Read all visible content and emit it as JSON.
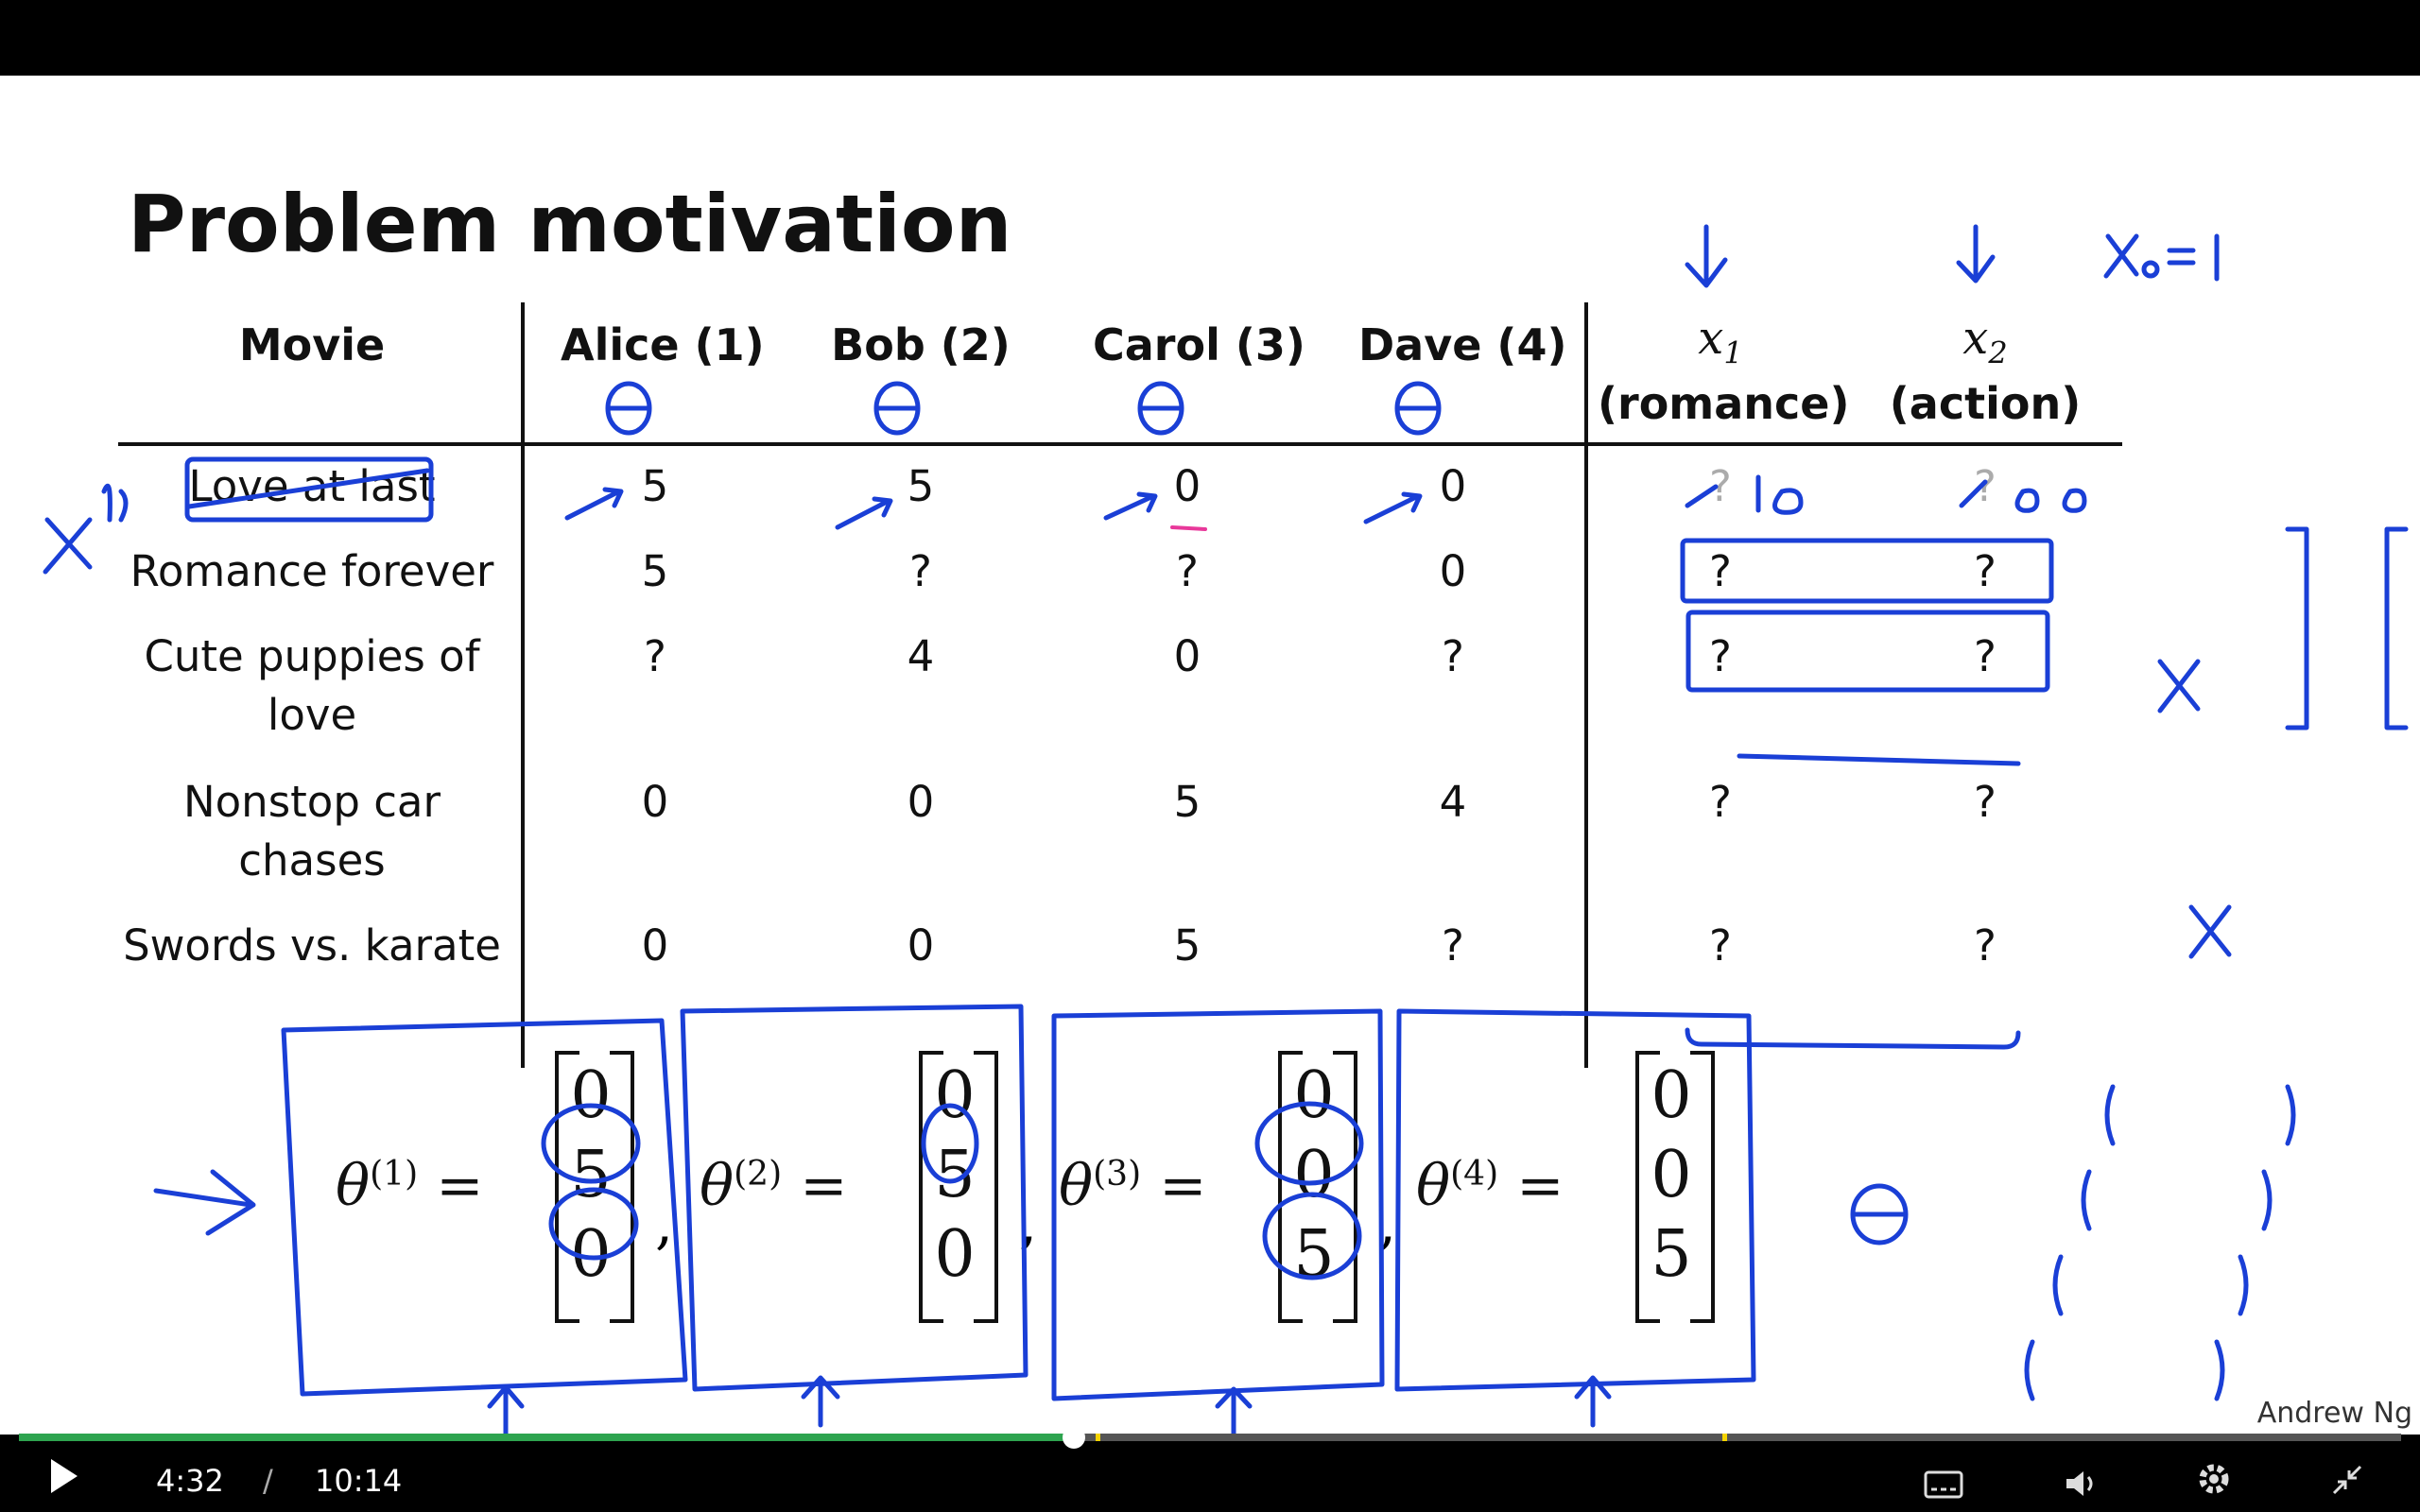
{
  "slide": {
    "title": "Problem motivation",
    "table": {
      "movie_header": "Movie",
      "users": [
        {
          "name": "Alice (1)"
        },
        {
          "name": "Bob (2)"
        },
        {
          "name": "Carol (3)"
        },
        {
          "name": "Dave (4)"
        }
      ],
      "features": [
        {
          "symbol": "x",
          "sub": "1",
          "label": "(romance)"
        },
        {
          "symbol": "x",
          "sub": "2",
          "label": "(action)"
        }
      ],
      "rows": [
        {
          "movie": "Love at last",
          "ratings": [
            "5",
            "5",
            "0",
            "0"
          ],
          "features": [
            "?",
            "?"
          ]
        },
        {
          "movie": "Romance forever",
          "ratings": [
            "5",
            "?",
            "?",
            "0"
          ],
          "features": [
            "?",
            "?"
          ]
        },
        {
          "movie": "Cute puppies of love",
          "ratings": [
            "?",
            "4",
            "0",
            "?"
          ],
          "features": [
            "?",
            "?"
          ]
        },
        {
          "movie": "Nonstop car chases",
          "ratings": [
            "0",
            "0",
            "5",
            "4"
          ],
          "features": [
            "?",
            "?"
          ]
        },
        {
          "movie": "Swords vs. karate",
          "ratings": [
            "0",
            "0",
            "5",
            "?"
          ],
          "features": [
            "?",
            "?"
          ]
        }
      ]
    },
    "thetas": [
      {
        "label": "θ",
        "sup": "(1)",
        "values": [
          "0",
          "5",
          "0"
        ]
      },
      {
        "label": "θ",
        "sup": "(2)",
        "values": [
          "0",
          "5",
          "0"
        ]
      },
      {
        "label": "θ",
        "sup": "(3)",
        "values": [
          "0",
          "0",
          "5"
        ]
      },
      {
        "label": "θ",
        "sup": "(4)",
        "values": [
          "0",
          "0",
          "5"
        ]
      }
    ],
    "equals": "=",
    "separator": ",",
    "credit": "Andrew Ng"
  },
  "player": {
    "current_time": "4:32",
    "time_separator": "/",
    "duration": "10:14",
    "progress_fraction": 0.443,
    "progress_color": "#2ea44f",
    "chapter_marks": [
      0.452,
      0.715
    ],
    "chapter_mark_color": "#f5d400",
    "icons": [
      "play-icon",
      "captions-icon",
      "volume-icon",
      "settings-icon",
      "exit-fullscreen-icon"
    ]
  }
}
